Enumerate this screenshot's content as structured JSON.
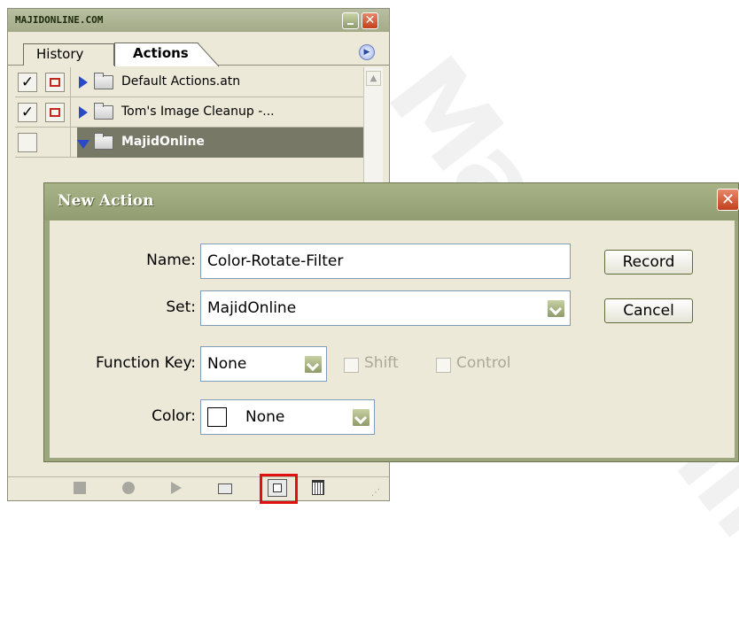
{
  "watermark": {
    "text": "MajidOnline"
  },
  "panel": {
    "title": "MAJIDONLINE.COM",
    "tabs": [
      {
        "label": "History",
        "active": false
      },
      {
        "label": "Actions",
        "active": true
      }
    ],
    "rows": [
      {
        "checked": true,
        "dialog_toggle": true,
        "expanded": false,
        "label": "Default Actions.atn",
        "selected": false
      },
      {
        "checked": true,
        "dialog_toggle": true,
        "expanded": false,
        "label": "Tom's Image Cleanup -...",
        "selected": false
      },
      {
        "checked": false,
        "dialog_toggle": false,
        "expanded": true,
        "label": "MajidOnline",
        "selected": true
      }
    ],
    "toolbar": [
      "stop-icon",
      "record-icon",
      "play-icon",
      "new-set-icon",
      "new-action-icon",
      "trash-icon"
    ]
  },
  "dialog": {
    "title": "New Action",
    "name_label": "Name:",
    "name_value": "Color-Rotate-Filter",
    "set_label": "Set:",
    "set_value": "MajidOnline",
    "function_key_label": "Function Key:",
    "function_key_value": "None",
    "shift_label": "Shift",
    "control_label": "Control",
    "color_label": "Color:",
    "color_value": "None",
    "record_label": "Record",
    "cancel_label": "Cancel"
  },
  "colors": {
    "xp_olive_title": "#a3ab88",
    "highlight_red": "#e01010",
    "selected_row": "#777966",
    "face": "#ece9d8"
  }
}
